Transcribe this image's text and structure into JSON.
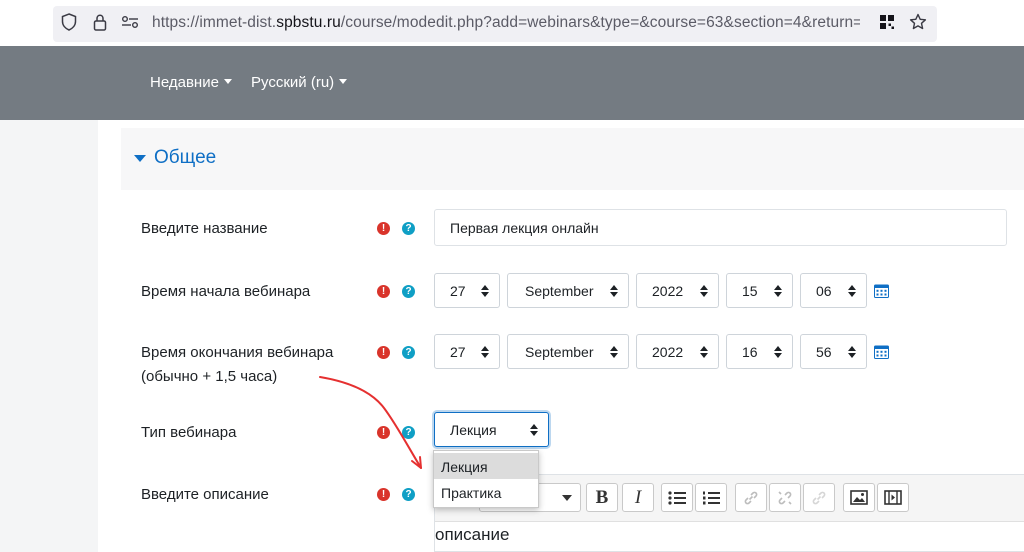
{
  "browser": {
    "url_prefix": "https://immet-dist.",
    "url_host": "spbstu.ru",
    "url_path": "/course/modedit.php?add=webinars&type=&course=63&section=4&return="
  },
  "navbar": {
    "recent_label": "Недавние",
    "language_label": "Русский (ru)"
  },
  "section": {
    "title": "Общее"
  },
  "form": {
    "name_label": "Введите название",
    "name_value": "Первая лекция онлайн",
    "start_label": "Время начала вебинара",
    "start": {
      "day": "27",
      "month": "September",
      "year": "2022",
      "hour": "15",
      "minute": "06"
    },
    "end_label_line1": "Время окончания вебинара",
    "end_label_line2": "(обычно + 1,5 часа)",
    "end": {
      "day": "27",
      "month": "September",
      "year": "2022",
      "hour": "16",
      "minute": "56"
    },
    "type_label": "Тип вебинара",
    "type_value": "Лекция",
    "type_options": [
      "Лекция",
      "Практика"
    ],
    "description_label": "Введите описание",
    "description_text": "описание"
  },
  "icons": {
    "required": "exclamation-circle-icon",
    "help": "question-circle-icon",
    "calendar": "calendar-icon"
  },
  "colors": {
    "navbar": "#747b82",
    "link": "#0f6fc5",
    "required": "#d9342b",
    "help": "#0f9fc5",
    "annotation_arrow": "#e53030"
  }
}
